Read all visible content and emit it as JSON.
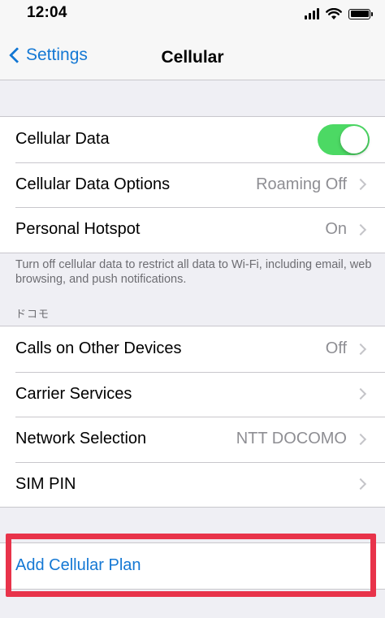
{
  "status_bar": {
    "time": "12:04"
  },
  "nav": {
    "back_label": "Settings",
    "title": "Cellular"
  },
  "group1": {
    "rows": [
      {
        "label": "Cellular Data",
        "value": "",
        "toggle_on": true
      },
      {
        "label": "Cellular Data Options",
        "value": "Roaming Off"
      },
      {
        "label": "Personal Hotspot",
        "value": "On"
      }
    ],
    "footer": "Turn off cellular data to restrict all data to Wi-Fi, including email, web browsing, and push notifications."
  },
  "carrier_section": {
    "header": "ドコモ",
    "rows": [
      {
        "label": "Calls on Other Devices",
        "value": "Off"
      },
      {
        "label": "Carrier Services",
        "value": ""
      },
      {
        "label": "Network Selection",
        "value": "NTT DOCOMO"
      },
      {
        "label": "SIM PIN",
        "value": ""
      }
    ]
  },
  "plan_section": {
    "add_plan_label": "Add Cellular Plan"
  },
  "colors": {
    "accent": "#1478d4",
    "toggle_on": "#4cd964",
    "highlight": "#e8334a",
    "background": "#efeff4"
  },
  "icons": [
    "signal-icon",
    "wifi-icon",
    "battery-icon",
    "back-chevron-icon",
    "chevron-right-icon"
  ]
}
